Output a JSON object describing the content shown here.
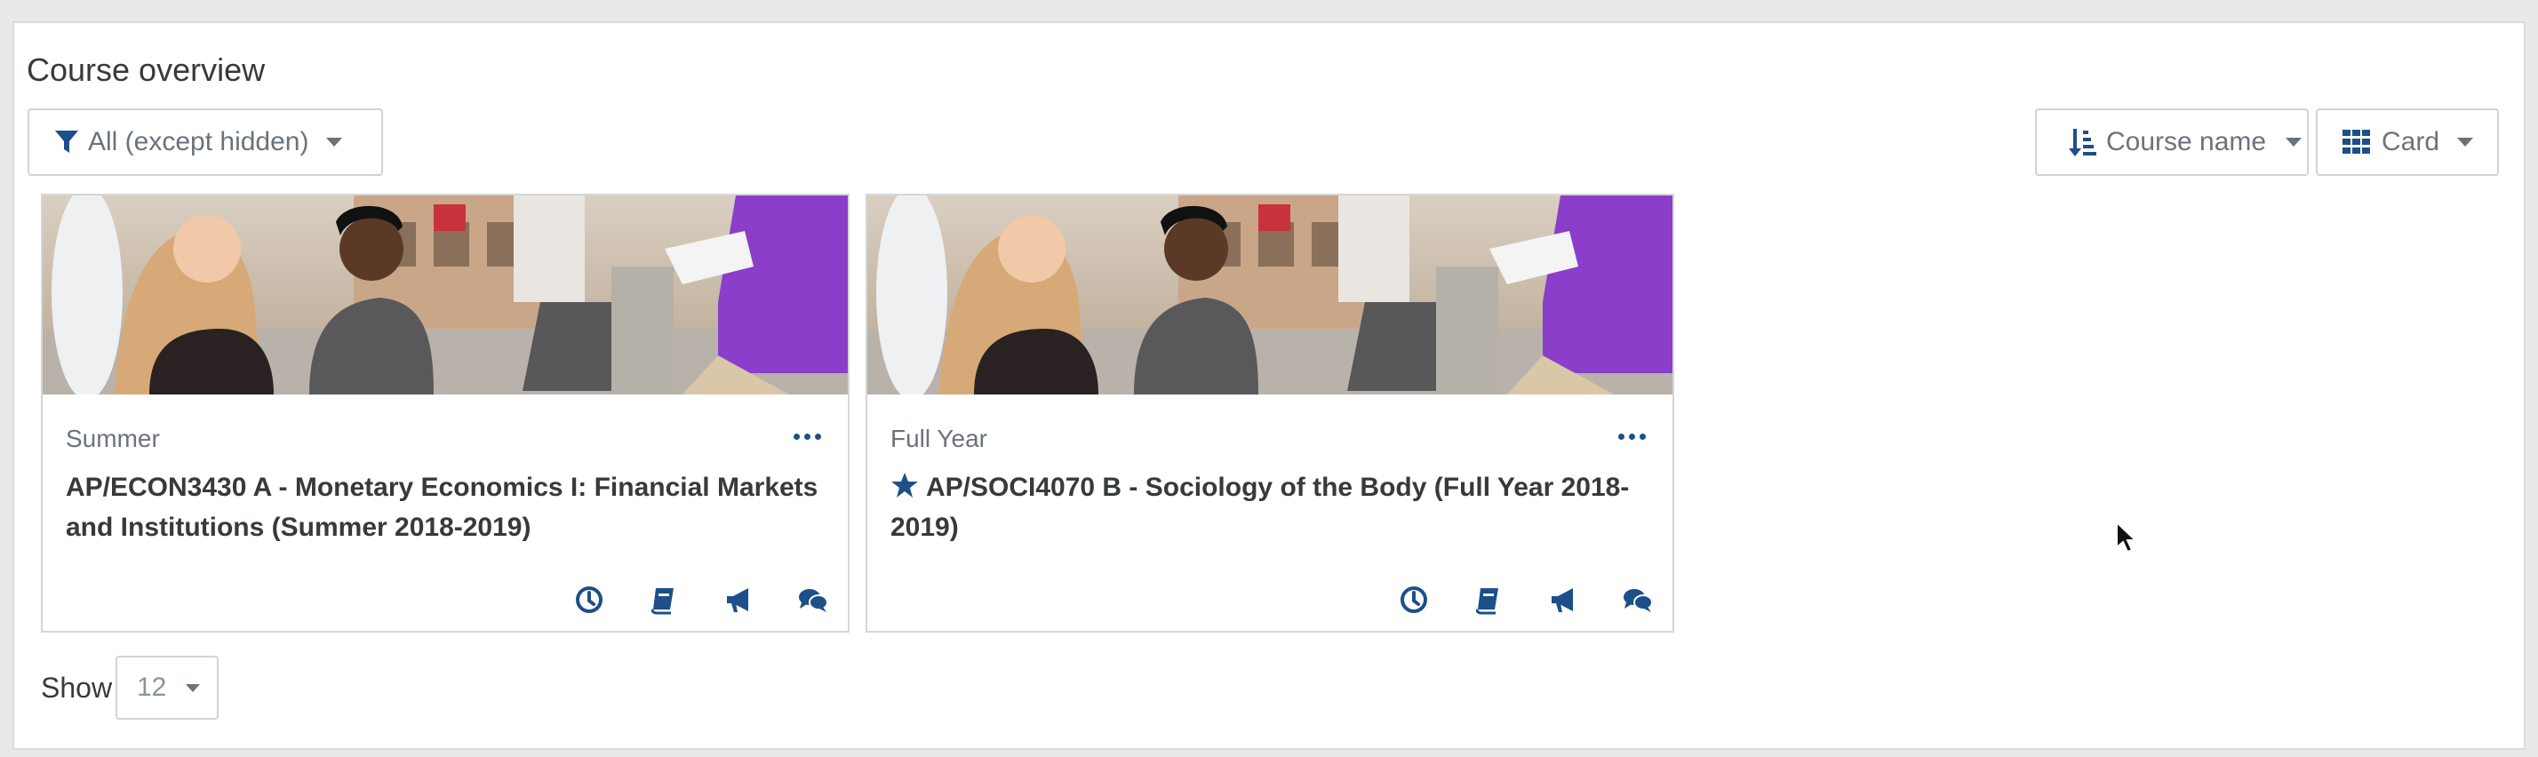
{
  "block": {
    "title": "Course overview"
  },
  "filter": {
    "label": "All (except hidden)"
  },
  "sort": {
    "label": "Course name"
  },
  "view": {
    "label": "Card"
  },
  "colors": {
    "accent": "#1d4f8a",
    "muted": "#6a737b",
    "border": "#ced4da"
  },
  "courses": [
    {
      "category": "Summer",
      "title": "AP/ECON3430 A - Monetary Economics I: Financial Markets and Institutions (Summer 2018-2019)",
      "starred": false,
      "actions": [
        "clock-icon",
        "book-icon",
        "megaphone-icon",
        "chat-icon"
      ]
    },
    {
      "category": "Full Year",
      "title": "AP/SOCI4070 B - Sociology of the Body (Full Year 2018-2019)",
      "starred": true,
      "actions": [
        "clock-icon",
        "book-icon",
        "megaphone-icon",
        "chat-icon"
      ]
    }
  ],
  "paging": {
    "show_label": "Show",
    "per_page": "12"
  }
}
